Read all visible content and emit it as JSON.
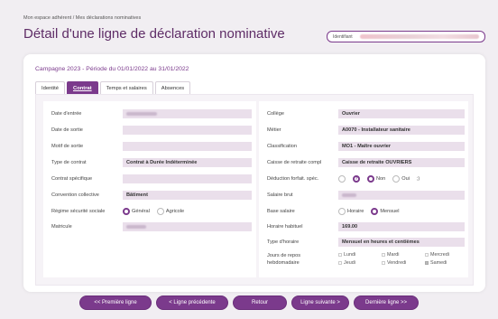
{
  "header": {
    "breadcrumb": "Mon espace adhérent / Mes déclarations nominatives",
    "title": "Détail d'une ligne de déclaration nominative",
    "identifier_label": "Identifiant"
  },
  "campaign": "Campagne 2023 - Période du 01/01/2022 au 31/01/2022",
  "tabs": [
    {
      "label": "Identité",
      "active": false
    },
    {
      "label": "Contrat",
      "active": true
    },
    {
      "label": "Temps et salaires",
      "active": false
    },
    {
      "label": "Absences",
      "active": false
    }
  ],
  "left": {
    "date_entree": {
      "label": "Date d'entrée",
      "value": ""
    },
    "date_sortie": {
      "label": "Date de sortie",
      "value": ""
    },
    "motif_sortie": {
      "label": "Motif de sortie",
      "value": ""
    },
    "type_contrat": {
      "label": "Type de contrat",
      "value": "Contrat à Durée Indéterminée"
    },
    "contrat_specifique": {
      "label": "Contrat spécifique",
      "value": ""
    },
    "convention": {
      "label": "Convention collective",
      "value": "Bâtiment"
    },
    "regime": {
      "label": "Régime sécurité sociale",
      "options": [
        "Général",
        "Agricole"
      ],
      "selected": "Général"
    },
    "matricule": {
      "label": "Matricule",
      "value": ""
    }
  },
  "right": {
    "college": {
      "label": "Collège",
      "value": "Ouvrier"
    },
    "metier": {
      "label": "Métier",
      "value": "A0070 - Installateur sanitaire"
    },
    "classification": {
      "label": "Classification",
      "value": "MO1 - Maître ouvrier"
    },
    "caisse": {
      "label": "Caisse de retraite compl",
      "value": "Caisse de retraite OUVRIERS"
    },
    "deduction": {
      "label": "Déduction forfait. spéc.",
      "options": [
        "Non",
        "Oui"
      ],
      "selected": "Non",
      "help": "?"
    },
    "salaire": {
      "label": "Salaire brut",
      "value": ""
    },
    "base_salaire": {
      "label": "Base salaire",
      "options": [
        "Horaire",
        "Mensuel"
      ],
      "selected": "Mensuel"
    },
    "horaire": {
      "label": "Horaire habituel",
      "value": "169.00"
    },
    "type_horaire": {
      "label": "Type d'horaire",
      "value": "Mensuel en heures et centièmes"
    },
    "jours_repos": {
      "label_line1": "Jours de repos",
      "label_line2": "hebdomadaire",
      "days": [
        {
          "label": "Lundi",
          "checked": false
        },
        {
          "label": "Mardi",
          "checked": false
        },
        {
          "label": "Mercredi",
          "checked": false
        },
        {
          "label": "Jeudi",
          "checked": false
        },
        {
          "label": "Vendredi",
          "checked": false
        },
        {
          "label": "Samedi",
          "checked": true
        }
      ]
    }
  },
  "nav": {
    "first": "<< Première ligne",
    "previous": "< Ligne précédente",
    "back": "Retour",
    "next": "Ligne suivante >",
    "last": "Dernière ligne >>"
  },
  "colors": {
    "accent": "#7b3a8c",
    "title": "#5e2c66",
    "field_bg": "#eadfeb"
  }
}
